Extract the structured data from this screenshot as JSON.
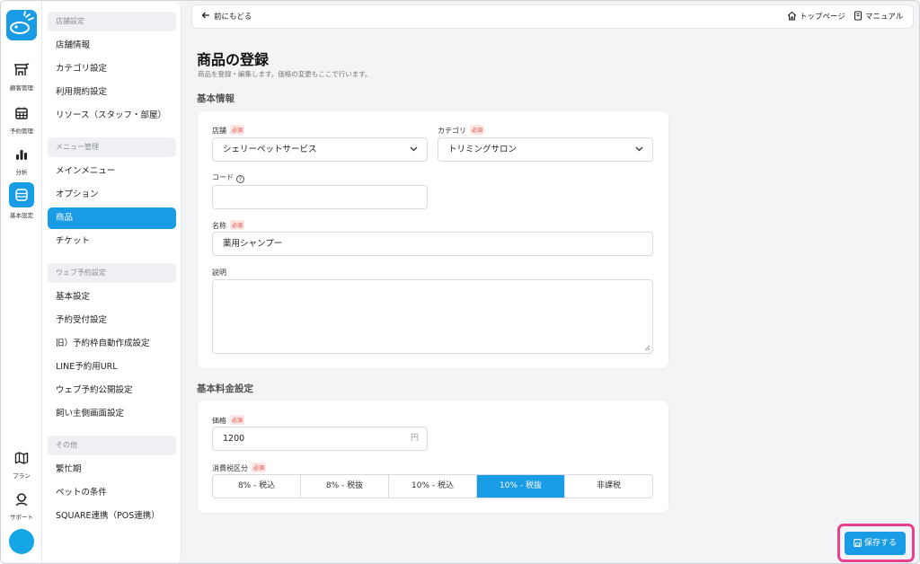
{
  "rail": {
    "items": [
      {
        "label": "顧客管理",
        "icon": "shop-icon"
      },
      {
        "label": "予約管理",
        "icon": "calendar-icon"
      },
      {
        "label": "分析",
        "icon": "bar-chart-icon"
      },
      {
        "label": "基本設定",
        "icon": "settings-box-icon"
      },
      {
        "label": "プラン",
        "icon": "map-icon"
      },
      {
        "label": "サポート",
        "icon": "support-icon"
      }
    ],
    "active": "基本設定"
  },
  "subnav": {
    "sections": [
      {
        "title": "店舗設定",
        "items": [
          "店舗情報",
          "カテゴリ設定",
          "利用規約設定",
          "リソース（スタッフ・部屋）"
        ]
      },
      {
        "title": "メニュー管理",
        "items": [
          "メインメニュー",
          "オプション",
          "商品",
          "チケット"
        ]
      },
      {
        "title": "ウェブ予約設定",
        "items": [
          "基本設定",
          "予約受付設定",
          "旧）予約枠自動作成設定",
          "LINE予約用URL",
          "ウェブ予約公開設定",
          "飼い主側画面設定"
        ]
      },
      {
        "title": "その他",
        "items": [
          "繁忙期",
          "ペットの条件",
          "SQUARE連携（POS連携）"
        ]
      }
    ],
    "active": "商品"
  },
  "topbar": {
    "back_label": "前にもどる",
    "top_page_label": "トップページ",
    "manual_label": "マニュアル"
  },
  "page": {
    "title": "商品の登録",
    "subtitle": "商品を登録・編集します。価格の変更もここで行います。"
  },
  "basic": {
    "section_title": "基本情報",
    "store_label": "店舗",
    "store_value": "シェリーペットサービス",
    "category_label": "カテゴリ",
    "category_value": "トリミングサロン",
    "code_label": "コード",
    "code_value": "",
    "name_label": "名称",
    "name_value": "薬用シャンプー",
    "desc_label": "説明",
    "desc_value": ""
  },
  "pricing": {
    "section_title": "基本料金設定",
    "price_label": "価格",
    "price_value": "1200",
    "price_unit": "円",
    "tax_label": "消費税区分",
    "tax_options": [
      "8% - 税込",
      "8% - 税抜",
      "10% - 税込",
      "10% - 税抜",
      "非課税"
    ],
    "tax_selected": "10% - 税抜"
  },
  "required_label": "必須",
  "help_glyph": "?",
  "save_label": "保存する",
  "colors": {
    "accent": "#1a9be6",
    "highlight": "#ea3f8f",
    "required": "#e0443a"
  }
}
